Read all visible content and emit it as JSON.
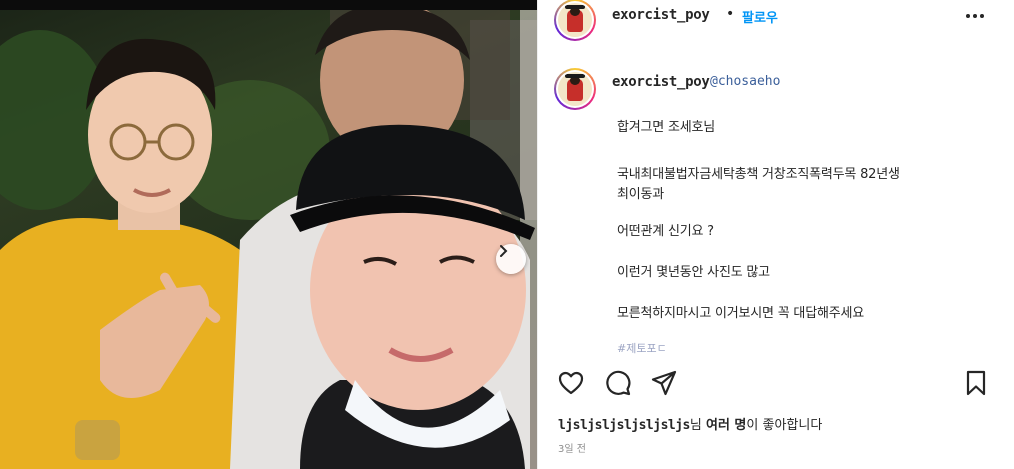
{
  "post": {
    "username": "exorcist_poy",
    "follow_label": "팔로우",
    "dot": "•",
    "caption": {
      "username": "exorcist_poy",
      "mention": "@chosaeho",
      "lines": [
        "합겨그면 조세호님",
        "국내최대불법자금세탁총책 거창조직폭력두목 82년생",
        "최이동과",
        "어떤관계 신기요 ?",
        "이런거 몇년동안 사진도 많고",
        "모른척하지마시고 이거보시면 꼭 대답해주세요"
      ],
      "truncated_line": "#제토포ㄷ"
    },
    "likes": {
      "liker": "ljsljsljsljsljsljs",
      "suffix_particle": "님 ",
      "others": "여러 명",
      "suffix": "이 좋아합니다"
    },
    "timestamp": "3일 전"
  },
  "icons": {
    "more": "more-options-icon",
    "like": "heart-icon",
    "comment": "comment-icon",
    "share": "share-icon",
    "save": "bookmark-icon",
    "carousel": "chevron-right-icon"
  },
  "colors": {
    "follow": "#0095f6",
    "mention": "#3b5f9a",
    "text": "#262626",
    "muted": "#8e8e8e"
  }
}
